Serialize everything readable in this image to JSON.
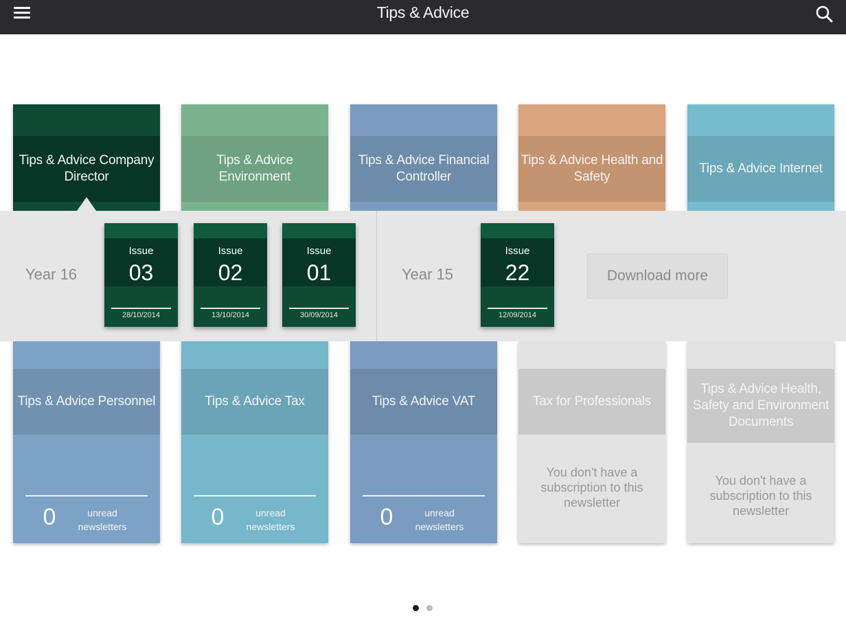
{
  "app": {
    "title": "Tips & Advice",
    "menu_icon": "hamburger-menu-icon",
    "search_icon": "search-icon"
  },
  "tiles_top": [
    {
      "title": "Tips & Advice Company Director",
      "color": "#0d4b34"
    },
    {
      "title": "Tips & Advice Environment",
      "color": "#7ab48f"
    },
    {
      "title": "Tips & Advice Financial Controller",
      "color": "#7a9cc0"
    },
    {
      "title": "Tips & Advice Health and Safety",
      "color": "#d9a47e"
    },
    {
      "title": "Tips & Advice Internet",
      "color": "#76bccf"
    }
  ],
  "tiles_bottom": [
    {
      "title": "Tips & Advice Personnel",
      "count": "0",
      "unread_label": "unread newsletters"
    },
    {
      "title": "Tips & Advice Tax",
      "count": "0",
      "unread_label": "unread newsletters"
    },
    {
      "title": "Tips & Advice VAT",
      "count": "0",
      "unread_label": "unread newsletters"
    },
    {
      "title": "Tax for Professionals",
      "message": "You don't have a subscription to this newsletter"
    },
    {
      "title": "Tips & Advice Health, Safety and Environment Documents",
      "message": "You don't have a subscription to this newsletter"
    }
  ],
  "issues_panel": {
    "groups": [
      {
        "year": "Year 16",
        "issues": [
          {
            "label": "Issue",
            "number": "03",
            "date": "28/10/2014"
          },
          {
            "label": "Issue",
            "number": "02",
            "date": "13/10/2014"
          },
          {
            "label": "Issue",
            "number": "01",
            "date": "30/09/2014"
          }
        ]
      },
      {
        "year": "Year 15",
        "issues": [
          {
            "label": "Issue",
            "number": "22",
            "date": "12/09/2014"
          }
        ]
      }
    ],
    "download_more": "Download more"
  },
  "pagination": {
    "pages": 2,
    "current": 1
  }
}
